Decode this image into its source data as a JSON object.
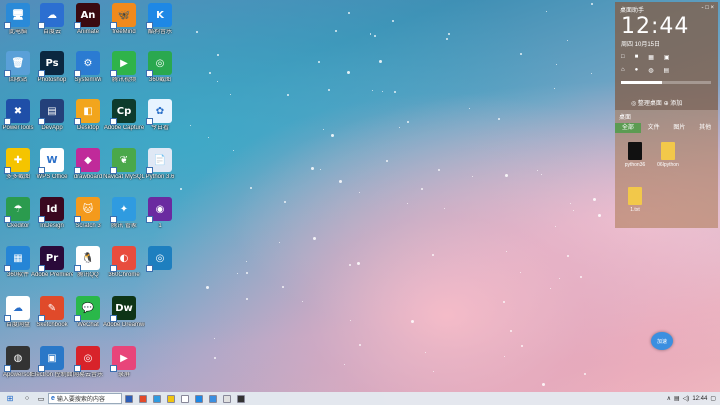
{
  "desktop_icons": [
    {
      "label": "此电脑",
      "icon": "computer-icon",
      "color": "#2a8ad8",
      "glyph": "🖥"
    },
    {
      "label": "百度云",
      "icon": "baidu-cloud-icon",
      "color": "#2c6fd1",
      "glyph": "☁"
    },
    {
      "label": "Animate",
      "icon": "adobe-animate-icon",
      "color": "#3a0a10",
      "glyph": "An"
    },
    {
      "label": "freeMind",
      "icon": "freemind-icon",
      "color": "#f08a1c",
      "glyph": "🦋"
    },
    {
      "label": "酷狗音乐",
      "icon": "kugou-icon",
      "color": "#1e88e5",
      "glyph": "K"
    },
    {
      "label": "回收站",
      "icon": "recycle-bin-icon",
      "color": "#5aa0d8",
      "glyph": "🗑"
    },
    {
      "label": "Photoshop",
      "icon": "photoshop-icon",
      "color": "#0b2740",
      "glyph": "Ps"
    },
    {
      "label": "SystemWi",
      "icon": "system-icon",
      "color": "#2b7bd2",
      "glyph": "⚙"
    },
    {
      "label": "腾讯视频",
      "icon": "tencent-video-icon",
      "color": "#2fb34a",
      "glyph": "▶"
    },
    {
      "label": "360截图",
      "icon": "screenshot-icon",
      "color": "#2aa84f",
      "glyph": "◎"
    },
    {
      "label": "PowerTools",
      "icon": "tools-icon",
      "color": "#1f4fa8",
      "glyph": "✖"
    },
    {
      "label": "DevApp",
      "icon": "dev-icon",
      "color": "#24407a",
      "glyph": "▤"
    },
    {
      "label": "Desktop",
      "icon": "desktop-icon",
      "color": "#f2a51c",
      "glyph": "◧"
    },
    {
      "label": "Adobe Capture",
      "icon": "adobe-capture-icon",
      "color": "#0e3b2c",
      "glyph": "Cp"
    },
    {
      "label": "今日看",
      "icon": "flower-icon",
      "color": "#e8f4ff",
      "glyph": "✿"
    },
    {
      "label": "多多截图",
      "icon": "plus-icon",
      "color": "#f5c400",
      "glyph": "✚"
    },
    {
      "label": "WPS Office",
      "icon": "wps-icon",
      "color": "#ffffff",
      "glyph": "W"
    },
    {
      "label": "drawboard",
      "icon": "draw-icon",
      "color": "#c02a9a",
      "glyph": "◆"
    },
    {
      "label": "Navicat MySQL",
      "icon": "navicat-icon",
      "color": "#4aa84a",
      "glyph": "❦"
    },
    {
      "label": "Python 3.6",
      "icon": "python-doc-icon",
      "color": "#dfe8f5",
      "glyph": "📄"
    },
    {
      "label": "Ckeditor",
      "icon": "umbrella-icon",
      "color": "#2b9b4e",
      "glyph": "☂"
    },
    {
      "label": "InDesign",
      "icon": "indesign-icon",
      "color": "#3a0820",
      "glyph": "Id"
    },
    {
      "label": "Scratch 3",
      "icon": "scratch-icon",
      "color": "#f49a1c",
      "glyph": "🐱"
    },
    {
      "label": "腾讯 管家",
      "icon": "tencent-manager-icon",
      "color": "#2f9be0",
      "glyph": "✦"
    },
    {
      "label": "1",
      "icon": "vortex-icon",
      "color": "#6a2aa0",
      "glyph": "◉"
    },
    {
      "label": "360软件",
      "icon": "app-store-icon",
      "color": "#2585d6",
      "glyph": "▦"
    },
    {
      "label": "Adobe Premiere",
      "icon": "premiere-icon",
      "color": "#2a0a3a",
      "glyph": "Pr"
    },
    {
      "label": "腾讯QQ",
      "icon": "qq-icon",
      "color": "#ffffff",
      "glyph": "🐧"
    },
    {
      "label": "360Chrome",
      "icon": "chrome-icon",
      "color": "#e84c3d",
      "glyph": "◐"
    },
    {
      "label": "",
      "icon": "image-icon",
      "color": "#1e7fbf",
      "glyph": "◎"
    },
    {
      "label": "百度网盘",
      "icon": "baidu-netdisk-icon",
      "color": "#ffffff",
      "glyph": "☁"
    },
    {
      "label": "Sketchbook",
      "icon": "sketchbook-icon",
      "color": "#e04a2a",
      "glyph": "✎"
    },
    {
      "label": "WeChat",
      "icon": "wechat-icon",
      "color": "#2ab84a",
      "glyph": "💬"
    },
    {
      "label": "Adobe Dreamweaver",
      "icon": "dreamweaver-icon",
      "color": "#0e3416",
      "glyph": "Dw"
    },
    {
      "label": "Apowersoft",
      "icon": "recorder-icon",
      "color": "#333333",
      "glyph": "◍"
    },
    {
      "label": "Electron 控制面板",
      "icon": "control-panel-icon",
      "color": "#2a78c8",
      "glyph": "▣"
    },
    {
      "label": "网易云音乐",
      "icon": "netease-music-icon",
      "color": "#d8232a",
      "glyph": "◎"
    },
    {
      "label": "录屏",
      "icon": "video-camera-icon",
      "color": "#e8457a",
      "glyph": "▶"
    }
  ],
  "fence": {
    "clock_title": "桌面助手",
    "clock_buttons": "- □ ×",
    "time": "12:44",
    "date": "周四 10月15日",
    "row1": [
      "□",
      "■",
      "▦",
      "▣"
    ],
    "row2": [
      "⌂",
      "●",
      "◍",
      "▤"
    ],
    "progress_fraction": 0.45,
    "footer": "◎ 整理桌面 ⊕ 添加",
    "files_title": "桌面",
    "tabs": [
      "全部",
      "文件",
      "图片",
      "其他"
    ],
    "active_tab": 0,
    "files": [
      {
        "label": "python36",
        "color": "#111111"
      },
      {
        "label": "06lpython",
        "color": "#f2c84a"
      },
      {
        "label": "1.txt",
        "color": "#f2c84a"
      }
    ]
  },
  "floating_ball": {
    "label": "加速"
  },
  "taskbar": {
    "search_placeholder": "输入要搜索的内容",
    "pinned": [
      "#2d5fb8",
      "#e34a2b",
      "#2f9be0",
      "#f1c40f",
      "#ffffff",
      "#1e88e5",
      "#3b8fe0",
      "#e0e0e0",
      "#333333"
    ],
    "time": "12:44"
  }
}
